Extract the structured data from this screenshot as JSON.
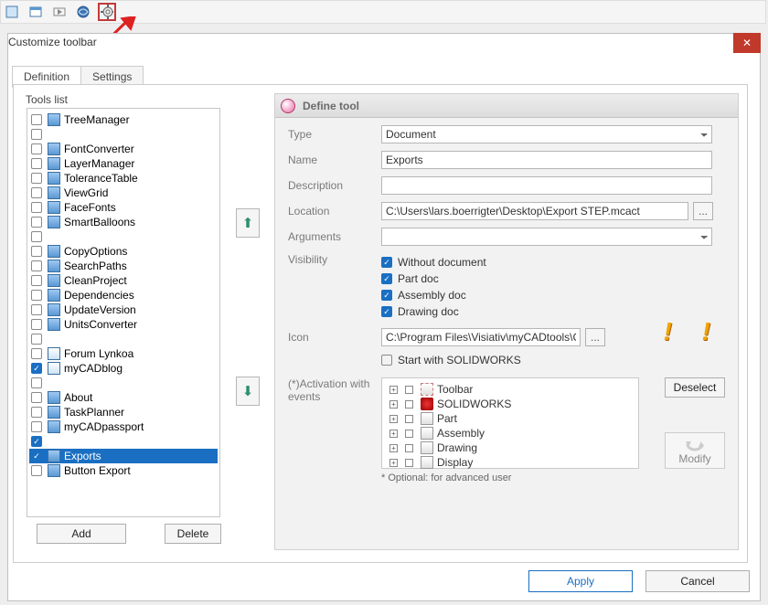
{
  "dialog": {
    "title": "Customize toolbar"
  },
  "tabs": {
    "definition": "Definition",
    "settings": "Settings"
  },
  "tools_list_label": "Tools list",
  "tools": [
    {
      "label": "TreeManager",
      "checked": false
    },
    {
      "label": "",
      "checked": false
    },
    {
      "label": "FontConverter",
      "checked": false
    },
    {
      "label": "LayerManager",
      "checked": false
    },
    {
      "label": "ToleranceTable",
      "checked": false
    },
    {
      "label": "ViewGrid",
      "checked": false
    },
    {
      "label": "FaceFonts",
      "checked": false
    },
    {
      "label": "SmartBalloons",
      "checked": false
    },
    {
      "label": "",
      "checked": false
    },
    {
      "label": "CopyOptions",
      "checked": false
    },
    {
      "label": "SearchPaths",
      "checked": false
    },
    {
      "label": "CleanProject",
      "checked": false
    },
    {
      "label": "Dependencies",
      "checked": false
    },
    {
      "label": "UpdateVersion",
      "checked": false
    },
    {
      "label": "UnitsConverter",
      "checked": false
    },
    {
      "label": "",
      "checked": false
    },
    {
      "label": "Forum Lynkoa",
      "checked": false,
      "alt": true
    },
    {
      "label": "myCADblog",
      "checked": true,
      "alt": true
    },
    {
      "label": "",
      "checked": false
    },
    {
      "label": "About",
      "checked": false
    },
    {
      "label": "TaskPlanner",
      "checked": false
    },
    {
      "label": "myCADpassport",
      "checked": false
    },
    {
      "label": "",
      "checked": true
    },
    {
      "label": "Exports",
      "checked": true,
      "selected": true
    },
    {
      "label": "Button Export",
      "checked": false
    }
  ],
  "add_btn": "Add",
  "delete_btn": "Delete",
  "header": "Define tool",
  "fields": {
    "type": "Type",
    "name": "Name",
    "description": "Description",
    "location": "Location",
    "arguments": "Arguments",
    "visibility": "Visibility",
    "icon": "Icon"
  },
  "values": {
    "type": "Document",
    "name": "Exports",
    "description": "",
    "location": "C:\\Users\\lars.boerrigter\\Desktop\\Export STEP.mcact",
    "arguments": "",
    "icon": "C:\\Program Files\\Visiativ\\myCADtools\\Custom"
  },
  "visibility_opts": [
    {
      "label": "Without document",
      "checked": true
    },
    {
      "label": "Part doc",
      "checked": true
    },
    {
      "label": "Assembly doc",
      "checked": true
    },
    {
      "label": "Drawing doc",
      "checked": true
    }
  ],
  "start_with": "Start with SOLIDWORKS",
  "events_label": "(*)Activation with events",
  "events": [
    "Toolbar",
    "SOLIDWORKS",
    "Part",
    "Assembly",
    "Drawing",
    "Display"
  ],
  "deselect": "Deselect",
  "modify": "Modify",
  "optional_note": "* Optional: for advanced user",
  "apply": "Apply",
  "cancel": "Cancel",
  "browse": "..."
}
